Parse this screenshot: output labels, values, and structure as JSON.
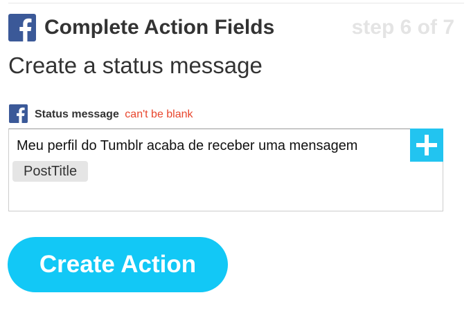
{
  "header": {
    "icon": "facebook-icon",
    "title": "Complete Action Fields",
    "step": "step 6 of 7"
  },
  "action": {
    "title": "Create a status message"
  },
  "field": {
    "icon": "facebook-icon",
    "label": "Status message",
    "error": "can't be blank",
    "text": "Meu perfil do Tumblr acaba de receber uma mensagem",
    "ingredient": "PostTitle",
    "add_icon": "plus-icon"
  },
  "button": {
    "label": "Create Action"
  },
  "colors": {
    "facebook": "#3b5998",
    "accent": "#12c8f6",
    "add_button": "#22c4f0",
    "error": "#e8452c",
    "step_text": "#e4e4e4"
  }
}
